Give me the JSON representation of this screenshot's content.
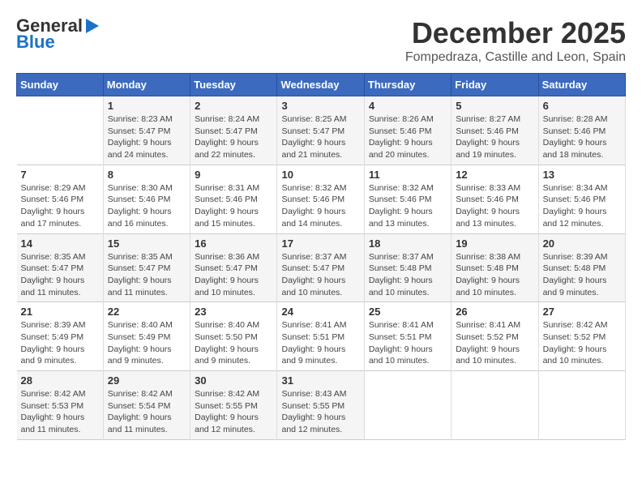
{
  "logo": {
    "line1": "General",
    "line2": "Blue"
  },
  "header": {
    "month": "December 2025",
    "location": "Fompedraza, Castille and Leon, Spain"
  },
  "days_of_week": [
    "Sunday",
    "Monday",
    "Tuesday",
    "Wednesday",
    "Thursday",
    "Friday",
    "Saturday"
  ],
  "weeks": [
    [
      {
        "day": "",
        "info": ""
      },
      {
        "day": "1",
        "info": "Sunrise: 8:23 AM\nSunset: 5:47 PM\nDaylight: 9 hours\nand 24 minutes."
      },
      {
        "day": "2",
        "info": "Sunrise: 8:24 AM\nSunset: 5:47 PM\nDaylight: 9 hours\nand 22 minutes."
      },
      {
        "day": "3",
        "info": "Sunrise: 8:25 AM\nSunset: 5:47 PM\nDaylight: 9 hours\nand 21 minutes."
      },
      {
        "day": "4",
        "info": "Sunrise: 8:26 AM\nSunset: 5:46 PM\nDaylight: 9 hours\nand 20 minutes."
      },
      {
        "day": "5",
        "info": "Sunrise: 8:27 AM\nSunset: 5:46 PM\nDaylight: 9 hours\nand 19 minutes."
      },
      {
        "day": "6",
        "info": "Sunrise: 8:28 AM\nSunset: 5:46 PM\nDaylight: 9 hours\nand 18 minutes."
      }
    ],
    [
      {
        "day": "7",
        "info": "Sunrise: 8:29 AM\nSunset: 5:46 PM\nDaylight: 9 hours\nand 17 minutes."
      },
      {
        "day": "8",
        "info": "Sunrise: 8:30 AM\nSunset: 5:46 PM\nDaylight: 9 hours\nand 16 minutes."
      },
      {
        "day": "9",
        "info": "Sunrise: 8:31 AM\nSunset: 5:46 PM\nDaylight: 9 hours\nand 15 minutes."
      },
      {
        "day": "10",
        "info": "Sunrise: 8:32 AM\nSunset: 5:46 PM\nDaylight: 9 hours\nand 14 minutes."
      },
      {
        "day": "11",
        "info": "Sunrise: 8:32 AM\nSunset: 5:46 PM\nDaylight: 9 hours\nand 13 minutes."
      },
      {
        "day": "12",
        "info": "Sunrise: 8:33 AM\nSunset: 5:46 PM\nDaylight: 9 hours\nand 13 minutes."
      },
      {
        "day": "13",
        "info": "Sunrise: 8:34 AM\nSunset: 5:46 PM\nDaylight: 9 hours\nand 12 minutes."
      }
    ],
    [
      {
        "day": "14",
        "info": "Sunrise: 8:35 AM\nSunset: 5:47 PM\nDaylight: 9 hours\nand 11 minutes."
      },
      {
        "day": "15",
        "info": "Sunrise: 8:35 AM\nSunset: 5:47 PM\nDaylight: 9 hours\nand 11 minutes."
      },
      {
        "day": "16",
        "info": "Sunrise: 8:36 AM\nSunset: 5:47 PM\nDaylight: 9 hours\nand 10 minutes."
      },
      {
        "day": "17",
        "info": "Sunrise: 8:37 AM\nSunset: 5:47 PM\nDaylight: 9 hours\nand 10 minutes."
      },
      {
        "day": "18",
        "info": "Sunrise: 8:37 AM\nSunset: 5:48 PM\nDaylight: 9 hours\nand 10 minutes."
      },
      {
        "day": "19",
        "info": "Sunrise: 8:38 AM\nSunset: 5:48 PM\nDaylight: 9 hours\nand 10 minutes."
      },
      {
        "day": "20",
        "info": "Sunrise: 8:39 AM\nSunset: 5:48 PM\nDaylight: 9 hours\nand 9 minutes."
      }
    ],
    [
      {
        "day": "21",
        "info": "Sunrise: 8:39 AM\nSunset: 5:49 PM\nDaylight: 9 hours\nand 9 minutes."
      },
      {
        "day": "22",
        "info": "Sunrise: 8:40 AM\nSunset: 5:49 PM\nDaylight: 9 hours\nand 9 minutes."
      },
      {
        "day": "23",
        "info": "Sunrise: 8:40 AM\nSunset: 5:50 PM\nDaylight: 9 hours\nand 9 minutes."
      },
      {
        "day": "24",
        "info": "Sunrise: 8:41 AM\nSunset: 5:51 PM\nDaylight: 9 hours\nand 9 minutes."
      },
      {
        "day": "25",
        "info": "Sunrise: 8:41 AM\nSunset: 5:51 PM\nDaylight: 9 hours\nand 10 minutes."
      },
      {
        "day": "26",
        "info": "Sunrise: 8:41 AM\nSunset: 5:52 PM\nDaylight: 9 hours\nand 10 minutes."
      },
      {
        "day": "27",
        "info": "Sunrise: 8:42 AM\nSunset: 5:52 PM\nDaylight: 9 hours\nand 10 minutes."
      }
    ],
    [
      {
        "day": "28",
        "info": "Sunrise: 8:42 AM\nSunset: 5:53 PM\nDaylight: 9 hours\nand 11 minutes."
      },
      {
        "day": "29",
        "info": "Sunrise: 8:42 AM\nSunset: 5:54 PM\nDaylight: 9 hours\nand 11 minutes."
      },
      {
        "day": "30",
        "info": "Sunrise: 8:42 AM\nSunset: 5:55 PM\nDaylight: 9 hours\nand 12 minutes."
      },
      {
        "day": "31",
        "info": "Sunrise: 8:43 AM\nSunset: 5:55 PM\nDaylight: 9 hours\nand 12 minutes."
      },
      {
        "day": "",
        "info": ""
      },
      {
        "day": "",
        "info": ""
      },
      {
        "day": "",
        "info": ""
      }
    ]
  ]
}
